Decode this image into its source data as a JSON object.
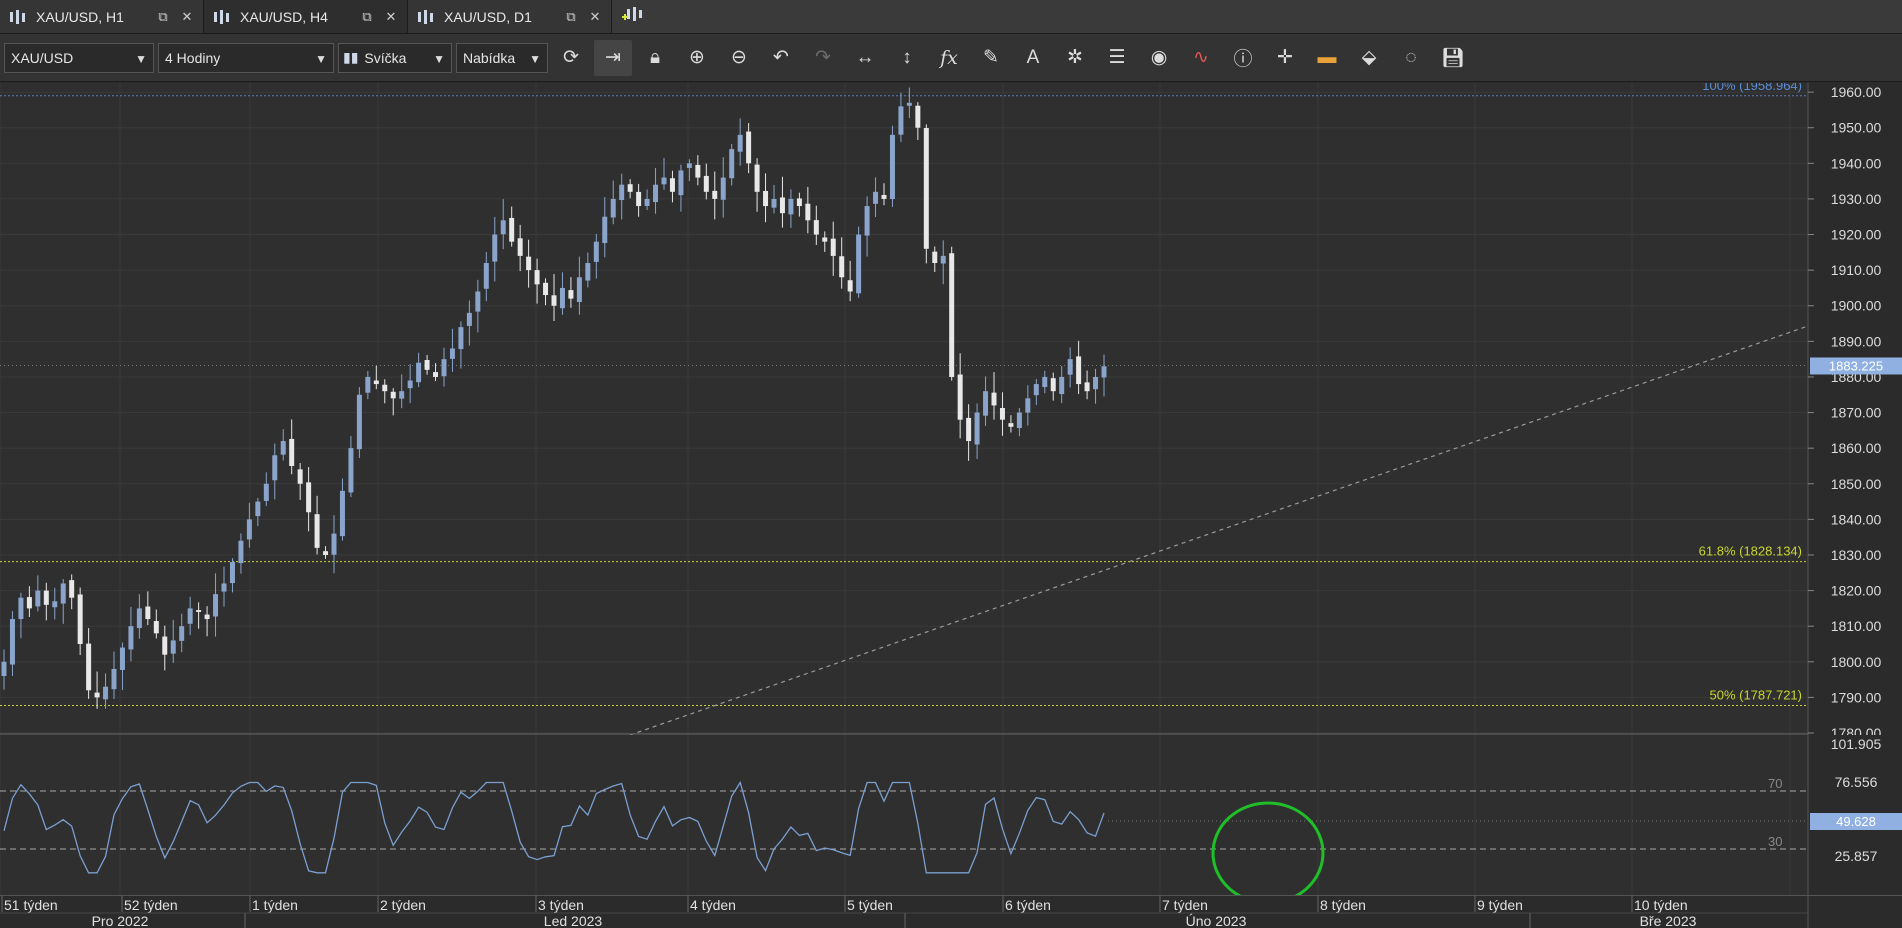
{
  "tabs": [
    {
      "label": "XAU/USD, H1",
      "active": false
    },
    {
      "label": "XAU/USD, H4",
      "active": true
    },
    {
      "label": "XAU/USD, D1",
      "active": false
    }
  ],
  "toolbar": {
    "instrument": "XAU/USD",
    "period": "4 Hodiny",
    "chart_type": "Svíčka",
    "price_side": "Nabídka",
    "tools": [
      "refresh-icon",
      "autoscroll-icon",
      "lock-icon",
      "zoom-in-icon",
      "zoom-out-icon",
      "undo-icon",
      "redo-icon",
      "horizontal-scale-icon",
      "vertical-scale-icon",
      "indicators-fx-icon",
      "pencil-icon",
      "text-icon",
      "objects-icon",
      "layers-icon",
      "eye-icon",
      "signals-icon",
      "info-icon",
      "crosshair-icon",
      "color-bars-icon",
      "paint-icon",
      "themes-icon",
      "save-icon"
    ]
  },
  "colors": {
    "background": "#2b2b2b",
    "bull": "#8aa4cc",
    "bear": "#e8e8e8",
    "fib_line": "#c9d62a",
    "fib_100_text": "#5a8ed8",
    "rsi_line": "#7a9fd0",
    "price_tag": "#8fb0e0",
    "circle": "#1fbf2a"
  },
  "price_axis": {
    "ticks": [
      "1960.00",
      "1950.00",
      "1940.00",
      "1930.00",
      "1920.00",
      "1910.00",
      "1900.00",
      "1890.00",
      "1880.00",
      "1870.00",
      "1860.00",
      "1850.00",
      "1840.00",
      "1830.00",
      "1820.00",
      "1810.00",
      "1800.00",
      "1790.00",
      "1780.00"
    ],
    "current_price": "1883.225"
  },
  "fib_levels": [
    {
      "label": "100% (1958.964)",
      "price": 1958.964
    },
    {
      "label": "61.8% (1828.134)",
      "price": 1828.134
    },
    {
      "label": "50% (1787.721)",
      "price": 1787.721
    }
  ],
  "rsi": {
    "axis_labels": [
      "101.905",
      "76.556",
      "25.857"
    ],
    "level_high": "70",
    "level_low": "30",
    "current_value": "49.628"
  },
  "time_axis": {
    "weeks": [
      "51 týden",
      "52 týden",
      "1 týden",
      "2 týden",
      "3 týden",
      "4 týden",
      "5 týden",
      "6 týden",
      "7 týden",
      "8 týden",
      "9 týden",
      "10 týden"
    ],
    "months": [
      "Pro 2022",
      "Led 2023",
      "Úno 2023",
      "Bře 2023"
    ]
  },
  "chart_data": {
    "type": "candlestick",
    "ylim": [
      1780,
      1962
    ],
    "series_close": [
      1800,
      1812,
      1818,
      1815,
      1820,
      1816,
      1817,
      1822,
      1818,
      1805,
      1792,
      1790,
      1793,
      1798,
      1804,
      1810,
      1815,
      1812,
      1808,
      1802,
      1806,
      1810,
      1815,
      1814,
      1812,
      1819,
      1822,
      1828,
      1834,
      1840,
      1845,
      1850,
      1858,
      1862,
      1855,
      1850,
      1842,
      1832,
      1830,
      1836,
      1848,
      1860,
      1875,
      1880,
      1878,
      1876,
      1874,
      1876,
      1879,
      1884,
      1882,
      1880,
      1885,
      1888,
      1894,
      1898,
      1904,
      1912,
      1920,
      1924,
      1918,
      1914,
      1910,
      1906,
      1903,
      1900,
      1905,
      1902,
      1908,
      1912,
      1918,
      1925,
      1930,
      1934,
      1932,
      1928,
      1930,
      1934,
      1936,
      1932,
      1938,
      1940,
      1936,
      1932,
      1930,
      1936,
      1944,
      1948,
      1940,
      1932,
      1928,
      1930,
      1926,
      1930,
      1928,
      1924,
      1920,
      1918,
      1914,
      1908,
      1904,
      1920,
      1928,
      1932,
      1930,
      1948,
      1956,
      1957,
      1950,
      1916,
      1912,
      1914,
      1880,
      1868,
      1862,
      1870,
      1876,
      1872,
      1868,
      1866,
      1870,
      1874,
      1878,
      1880,
      1876,
      1880,
      1885,
      1878,
      1876,
      1880,
      1883
    ]
  }
}
